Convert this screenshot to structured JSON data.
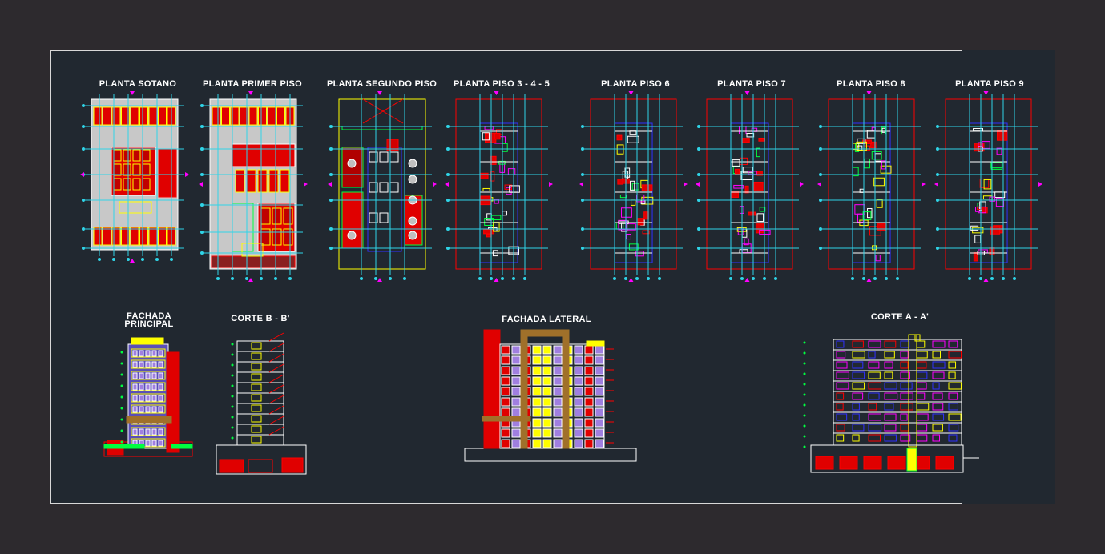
{
  "drawing": {
    "background_color": "#2d2a2e",
    "sheet_color": "#212830",
    "line_colors": {
      "grid": "#2fd5e8",
      "wall": "#ff0000",
      "fill_red": "#e00000",
      "magenta": "#ff00ff",
      "yellow": "#ffff00",
      "green": "#00ff40",
      "blue": "#3030ff",
      "white": "#ffffff",
      "brown": "#a0702a"
    },
    "plan_titles": [
      "PLANTA  SOTANO",
      "PLANTA PRIMER PISO",
      "PLANTA SEGUNDO PISO",
      "PLANTA PISO 3 - 4 - 5",
      "PLANTA PISO 6",
      "PLANTA PISO 7",
      "PLANTA PISO 8",
      "PLANTA PISO 9"
    ],
    "elevation_titles": {
      "fachada_principal_line1": "FACHADA",
      "fachada_principal_line2": "PRINCIPAL",
      "corte_b": "CORTE B - B'",
      "fachada_lateral": "FACHADA  LATERAL",
      "corte_a": "CORTE A - A'"
    }
  }
}
